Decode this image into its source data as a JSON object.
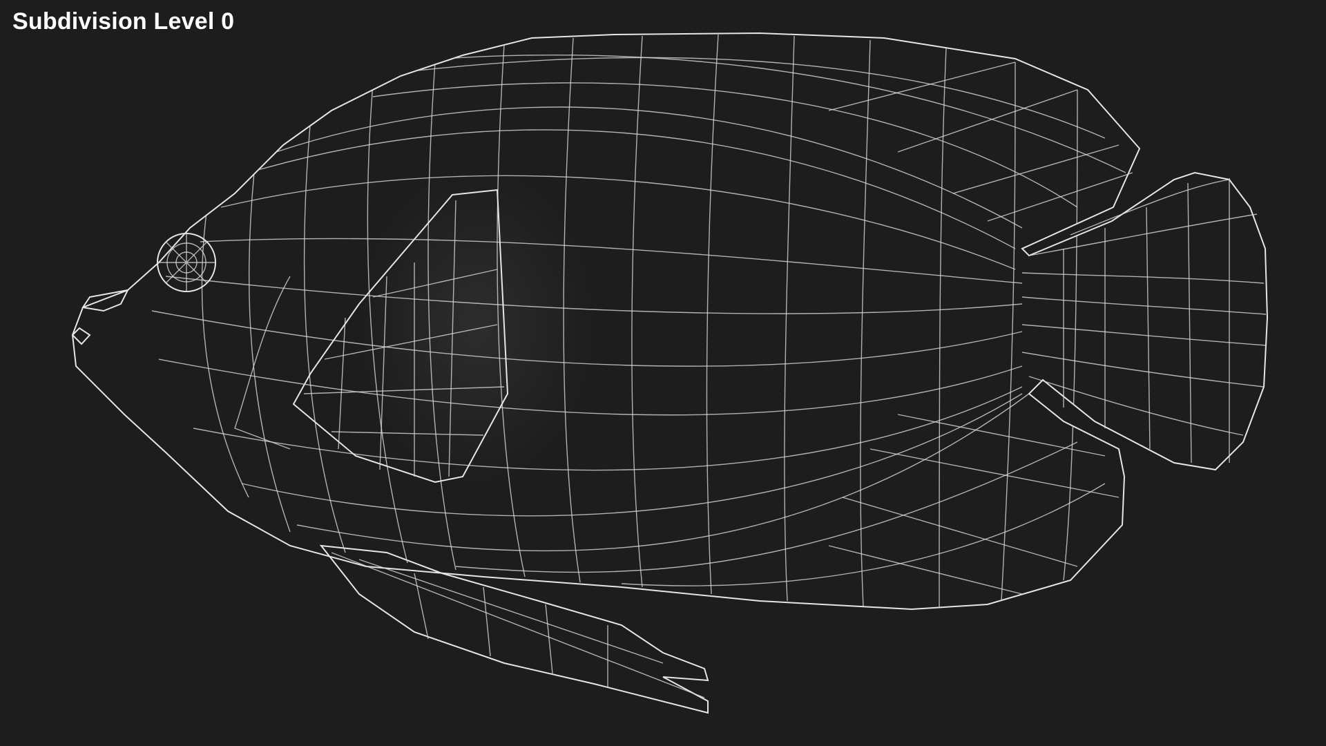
{
  "label": {
    "text": "Subdivision Level 0"
  },
  "render": {
    "subject": "angelfish-wireframe-model",
    "background_color": "#1d1d1d",
    "mesh_color": "#6b6b6b",
    "wire_color": "#d8d8d8"
  }
}
